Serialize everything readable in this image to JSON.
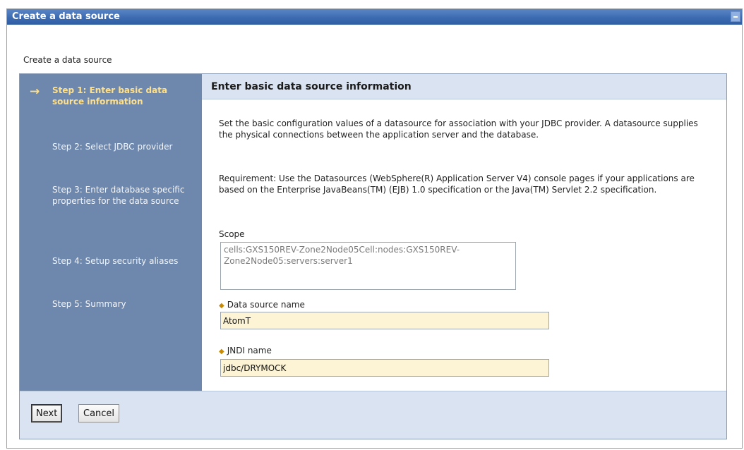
{
  "window": {
    "title": "Create a data source"
  },
  "page": {
    "heading": "Create a data source"
  },
  "steps": [
    {
      "label": "Step 1: Enter basic data source information",
      "current": true
    },
    {
      "label": "Step 2: Select JDBC provider",
      "current": false
    },
    {
      "label": "Step 3: Enter database specific properties for the data source",
      "current": false
    },
    {
      "label": "Step 4: Setup security aliases",
      "current": false
    },
    {
      "label": "Step 5: Summary",
      "current": false
    }
  ],
  "content": {
    "title": "Enter basic data source information",
    "description": "Set the basic configuration values of a datasource for association with your JDBC provider. A datasource supplies the physical connections between the application server and the database.",
    "requirement": "Requirement: Use the Datasources (WebSphere(R) Application Server V4) console pages if your applications are based on the Enterprise JavaBeans(TM) (EJB) 1.0 specification or the Java(TM) Servlet 2.2 specification.",
    "scope_label": "Scope",
    "scope_value": "cells:GXS150REV-Zone2Node05Cell:nodes:GXS150REV-Zone2Node05:servers:server1",
    "ds_name_label": "Data source name",
    "ds_name_value": "AtomT",
    "jndi_label": "JNDI name",
    "jndi_value": "jdbc/DRYMOCK"
  },
  "buttons": {
    "next": "Next",
    "cancel": "Cancel"
  },
  "icons": {
    "current_step": "arrow-right-icon",
    "required": "required-marker-icon",
    "collapse": "minimize-icon"
  },
  "colors": {
    "title_bar": "#3d6bb2",
    "step_nav": "#6e87ad",
    "current_step": "#ffe08a",
    "header_band": "#d9e3f1",
    "input_bg": "#fdf4d6"
  }
}
